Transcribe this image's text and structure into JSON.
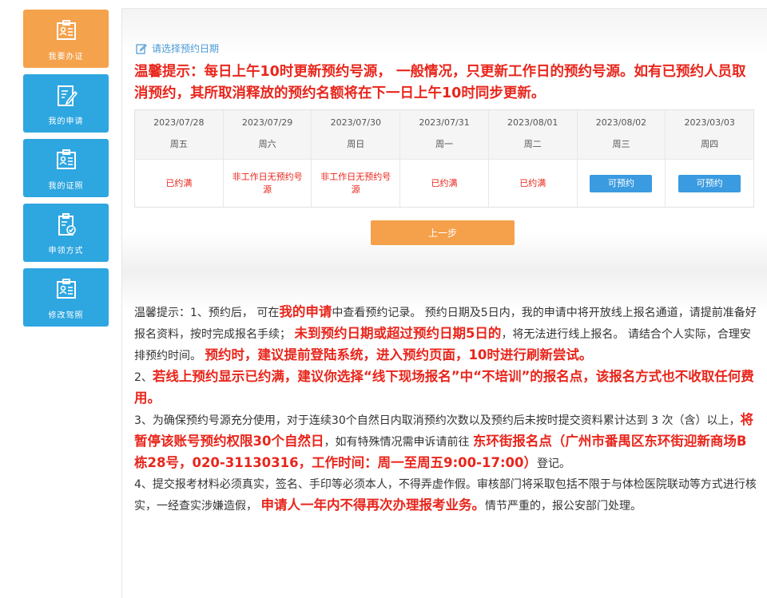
{
  "sidebar": {
    "items": [
      {
        "label": "我要办证",
        "icon": "id-card-icon",
        "active": true
      },
      {
        "label": "我的申请",
        "icon": "edit-document-icon",
        "active": false
      },
      {
        "label": "我的证照",
        "icon": "id-card-icon",
        "active": false
      },
      {
        "label": "申领方式",
        "icon": "checklist-icon",
        "active": false
      },
      {
        "label": "修改驾照",
        "icon": "id-card-icon",
        "active": false
      }
    ]
  },
  "section": {
    "title": "请选择预约日期"
  },
  "tip_top": "温馨提示：每日上午10时更新预约号源， 一般情况，只更新工作日的预约号源。如有已预约人员取消预约，其所取消释放的预约名额将在下一日上午10时同步更新。",
  "dates": [
    {
      "date": "2023/07/28",
      "week": "周五",
      "status": "已约满",
      "bookable": false
    },
    {
      "date": "2023/07/29",
      "week": "周六",
      "status": "非工作日无预约号源",
      "bookable": false
    },
    {
      "date": "2023/07/30",
      "week": "周日",
      "status": "非工作日无预约号源",
      "bookable": false
    },
    {
      "date": "2023/07/31",
      "week": "周一",
      "status": "已约满",
      "bookable": false
    },
    {
      "date": "2023/08/01",
      "week": "周二",
      "status": "已约满",
      "bookable": false
    },
    {
      "date": "2023/08/02",
      "week": "周三",
      "status": "可预约",
      "bookable": true
    },
    {
      "date": "2023/03/03",
      "week": "周四",
      "status": "可预约",
      "bookable": true
    }
  ],
  "prev_button": "上一步",
  "notes": {
    "p1_a": "温馨提示：1、预约后， 可在",
    "p1_b": "我的申请",
    "p1_c": "中查看预约记录。 预约日期及5日内，我的申请中将开放线上报名通道，请提前准备好报名资料，按时完成报名手续； ",
    "p1_d": "未到预约日期或超过预约日期5日的",
    "p1_e": "，将无法进行线上报名。 请结合个人实际，合理安排预约时间。 ",
    "p1_f": "预约时，建议提前登陆系统，进入预约页面，10时进行刷新尝试。",
    "p2_a": "2、",
    "p2_b": "若线上预约显示已约满，建议你选择“线下现场报名”中“不培训”的报名点，该报名方式也不收取任何费用。",
    "p3_a": "3、为确保预约号源充分使用，对于连续30个自然日内取消预约次数以及预约后未按时提交资料累计达到 3 次（含）以上，",
    "p3_b": "将暂停该账号预约权限30个自然日",
    "p3_c": "，如有特殊情况需申诉请前往 ",
    "p3_d": "东环街报名点（广州市番禺区东环街迎新商场B栋28号，020-31130316，工作时间：周一至周五9:00-17:00）",
    "p3_e": "登记。",
    "p4_a": "4、提交报考材料必须真实，签名、手印等必须本人，不得弄虚作假。审核部门将采取包括不限于与体检医院联动等方式进行核实，一经查实涉嫌造假， ",
    "p4_b": "申请人一年内不得再次办理报考业务。",
    "p4_c": "情节严重的，报公安部门处理。"
  },
  "colors": {
    "accent_orange": "#f5a24d",
    "accent_blue": "#2ea6e0",
    "alert_red": "#e8261c"
  }
}
